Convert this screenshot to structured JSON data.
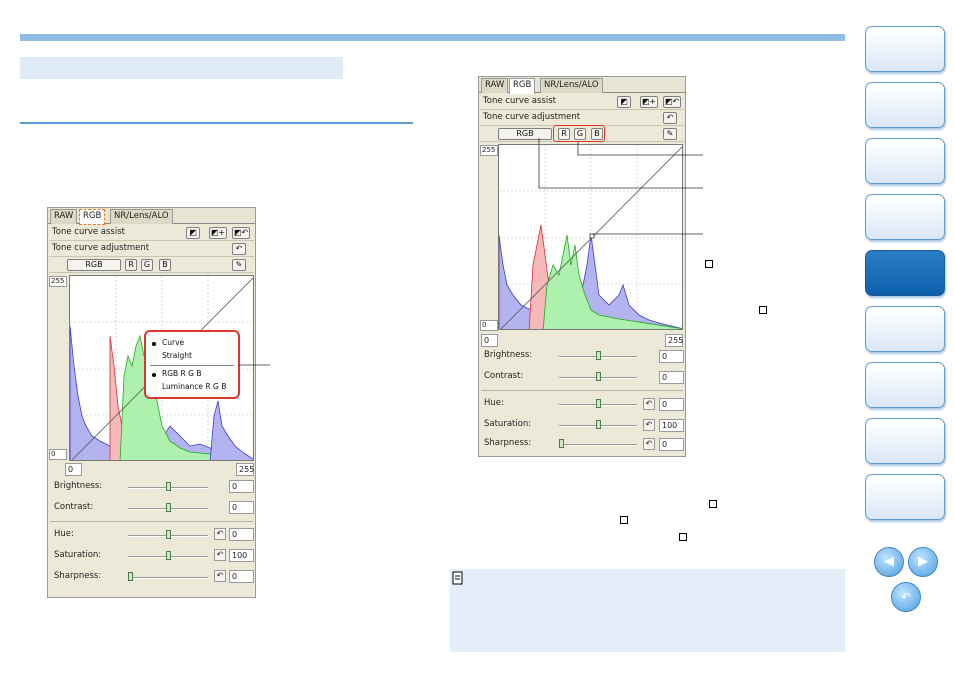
{
  "panel": {
    "tabs": [
      "RAW",
      "RGB",
      "NR/Lens/ALO"
    ],
    "tone_curve_assist": "Tone curve assist",
    "tone_curve_adjustment": "Tone curve adjustment",
    "channel_buttons": [
      "RGB",
      "R",
      "G",
      "B"
    ],
    "y_max": "255",
    "y_min": "0",
    "x_min": "0",
    "x_max": "255",
    "sliders": [
      {
        "label": "Brightness:",
        "value": "0",
        "level": 0.5
      },
      {
        "label": "Contrast:",
        "value": "0",
        "level": 0.5
      },
      {
        "label": "Hue:",
        "value": "0",
        "level": 0.5
      },
      {
        "label": "Saturation:",
        "value": "100",
        "level": 0.5
      },
      {
        "label": "Sharpness:",
        "value": "0",
        "level": 0.0
      }
    ]
  },
  "popup": {
    "items": [
      "Curve",
      "Straight",
      "RGB R G B",
      "Luminance R G B"
    ]
  },
  "colors": {
    "accent": "#5a9ad6",
    "highlight": "#e0352c",
    "active_nav": "#1566b2"
  },
  "icons": [
    "adjust-icon",
    "add-icon",
    "undo-icon",
    "eyedropper-icon",
    "note-icon",
    "prev-icon",
    "next-icon",
    "return-icon"
  ]
}
